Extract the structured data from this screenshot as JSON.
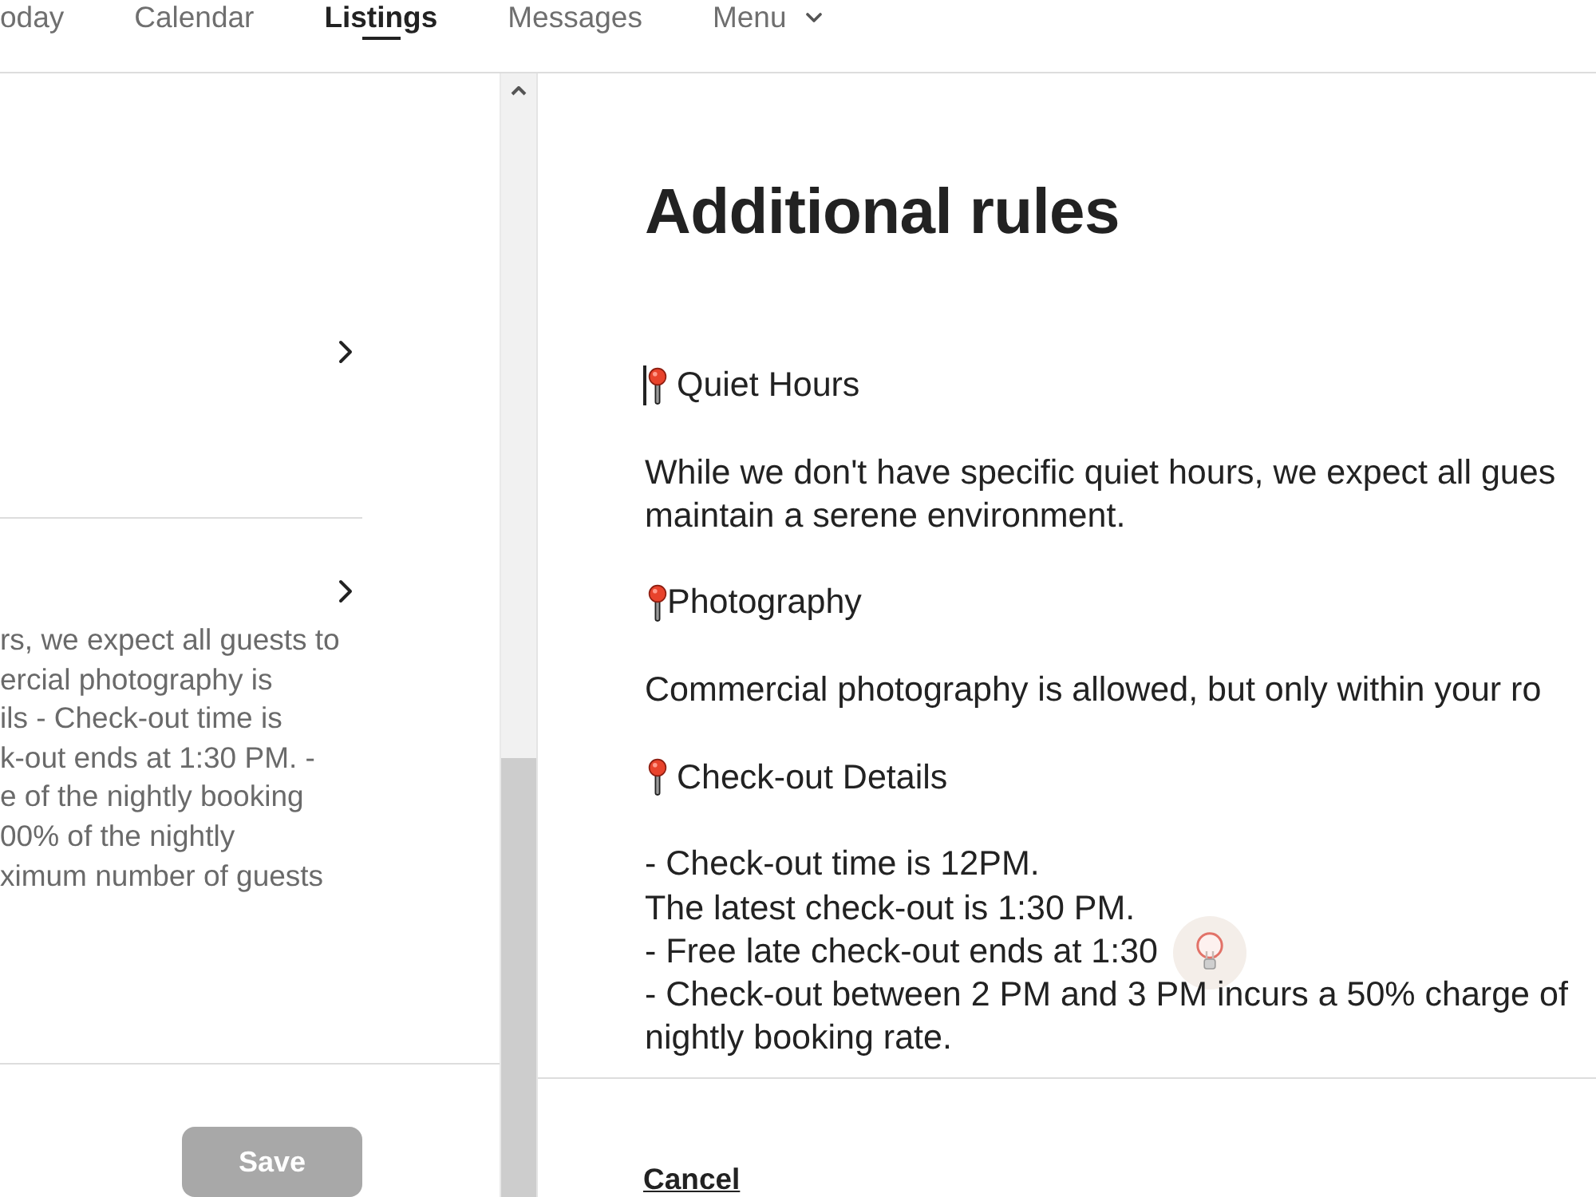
{
  "nav": {
    "tabs": [
      {
        "label": "oday",
        "selected": false,
        "dropdown": false
      },
      {
        "label": "Calendar",
        "selected": false,
        "dropdown": false
      },
      {
        "label": "Listings",
        "selected": true,
        "dropdown": false
      },
      {
        "label": "Messages",
        "selected": false,
        "dropdown": false
      },
      {
        "label": "Menu",
        "selected": false,
        "dropdown": true
      }
    ]
  },
  "settings_list": {
    "rows": [
      {
        "chevron": true
      },
      {
        "chevron": true,
        "summary": [
          "rs, we expect all guests to",
          "ercial photography is",
          "ils - Check-out time is",
          "k-out ends at 1:30 PM. -",
          "e of the nightly booking",
          "00% of the nightly",
          "ximum number of guests"
        ]
      }
    ]
  },
  "editor": {
    "title": "Additional rules",
    "sections": [
      {
        "title": " Quiet Hours",
        "caret": true,
        "entries": [
          {
            "lines": [
              "While we don't have specific quiet hours, we expect all gues",
              "maintain a serene environment."
            ],
            "lightbulb": false
          }
        ]
      },
      {
        "title": "Photography",
        "caret": false,
        "entries": [
          {
            "lines": [
              "Commercial photography is allowed, but only within your ro"
            ],
            "lightbulb": false
          }
        ]
      },
      {
        "title": " Check-out Details",
        "caret": false,
        "entries": [
          {
            "lines": [
              "- Check-out time is 12PM."
            ],
            "lightbulb": false
          },
          {
            "lines": [
              "The latest check-out is 1:30 PM."
            ],
            "lightbulb": false
          },
          {
            "lines": [
              "- Free late check-out ends at 1:30"
            ],
            "lightbulb": true
          },
          {
            "lines": [
              "- Check-out between 2 PM and 3 PM incurs a 50% charge of",
              "nightly booking rate."
            ],
            "lightbulb": false
          }
        ]
      }
    ]
  },
  "footer": {
    "save": {
      "label": "Save",
      "disabled": true
    },
    "cancel": {
      "label": "Cancel"
    }
  }
}
